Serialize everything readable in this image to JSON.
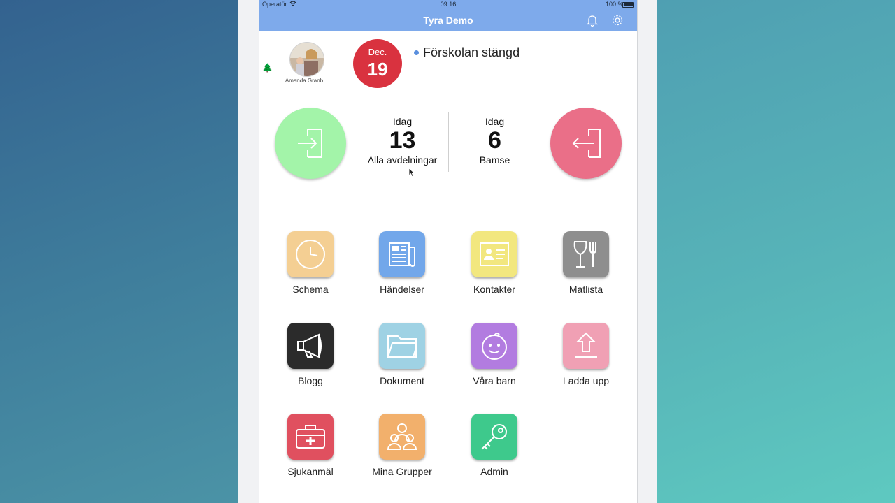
{
  "statusbar": {
    "carrier": "Operatör",
    "time": "09:16",
    "battery": "100 %"
  },
  "navbar": {
    "title": "Tyra Demo"
  },
  "info": {
    "user_name": "Amanda Granb…",
    "date_month": "Dec.",
    "date_day": "19",
    "status": "Förskolan stängd"
  },
  "stats": {
    "left": {
      "label": "Idag",
      "value": "13",
      "sub": "Alla avdelningar"
    },
    "right": {
      "label": "Idag",
      "value": "6",
      "sub": "Bamse"
    }
  },
  "tiles": [
    {
      "label": "Schema",
      "icon": "clock-icon",
      "color": "#f4cf93"
    },
    {
      "label": "Händelser",
      "icon": "newspaper-icon",
      "color": "#72a7ea"
    },
    {
      "label": "Kontakter",
      "icon": "contact-card-icon",
      "color": "#f2e77f"
    },
    {
      "label": "Matlista",
      "icon": "utensils-icon",
      "color": "#8e8e8e"
    },
    {
      "label": "Blogg",
      "icon": "megaphone-icon",
      "color": "#2b2b2b"
    },
    {
      "label": "Dokument",
      "icon": "folder-icon",
      "color": "#9fd2e4"
    },
    {
      "label": "Våra barn",
      "icon": "baby-face-icon",
      "color": "#b27ce0"
    },
    {
      "label": "Ladda upp",
      "icon": "upload-icon",
      "color": "#f0a0b4"
    },
    {
      "label": "Sjukanmäl",
      "icon": "first-aid-kit-icon",
      "color": "#e0505f"
    },
    {
      "label": "Mina Grupper",
      "icon": "group-icon",
      "color": "#f2b06c"
    },
    {
      "label": "Admin",
      "icon": "key-icon",
      "color": "#3ec98c"
    }
  ],
  "colors": {
    "navbar": "#7eaaeb",
    "date_badge": "#d9323f",
    "checkin": "#a3f4a9",
    "checkout": "#ea6f88"
  }
}
